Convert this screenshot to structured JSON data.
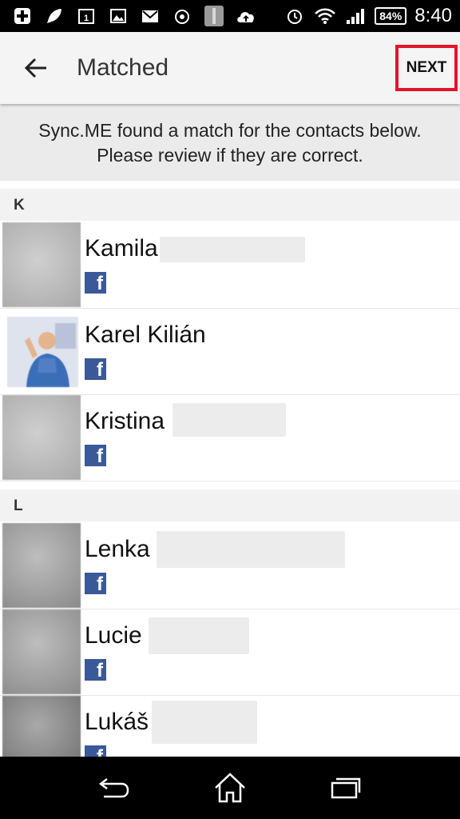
{
  "status_bar": {
    "battery": "84%",
    "time": "8:40",
    "left_icons": [
      "plus-icon",
      "rocket-icon",
      "calendar-icon",
      "image-icon",
      "gmail-icon",
      "alarm-app-icon",
      "app-icon",
      "upload-cloud-icon"
    ],
    "right_icons": [
      "alarm-icon",
      "wifi-icon",
      "signal-icon"
    ]
  },
  "app_bar": {
    "title": "Matched",
    "next_label": "NEXT",
    "highlight_color": "#e3142b"
  },
  "banner": {
    "line1": "Sync.ME found a match for the contacts below.",
    "line2": "Please review if they are correct."
  },
  "sections": [
    {
      "letter": "K",
      "contacts": [
        {
          "name": "Kamila",
          "source": "facebook"
        },
        {
          "name": "Karel Kilián",
          "source": "facebook"
        },
        {
          "name": "Kristina",
          "source": "facebook"
        }
      ]
    },
    {
      "letter": "L",
      "contacts": [
        {
          "name": "Lenka",
          "source": "facebook"
        },
        {
          "name": "Lucie",
          "source": "facebook"
        },
        {
          "name": "Lukáš",
          "source": "facebook"
        }
      ]
    }
  ],
  "nav_bar": {
    "icons": [
      "back-nav-icon",
      "home-icon",
      "recent-apps-icon"
    ]
  },
  "colors": {
    "facebook": "#3b5998",
    "app_bar_bg": "#f4f4f4",
    "banner_bg": "#ebebeb"
  }
}
